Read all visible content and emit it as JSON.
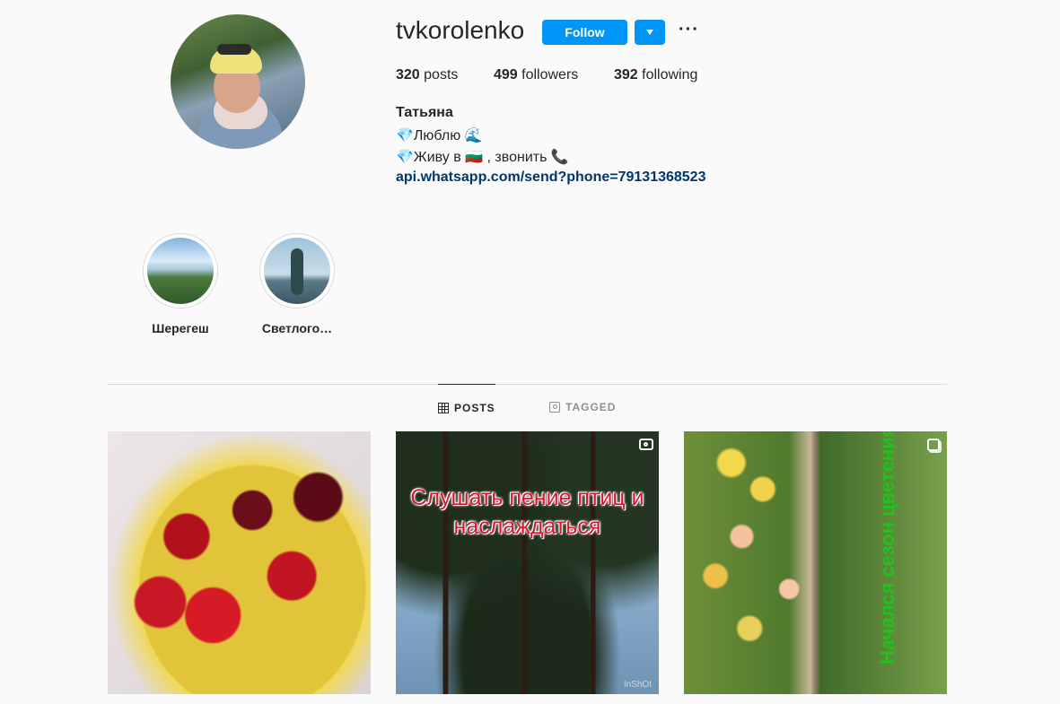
{
  "profile": {
    "username": "tvkorolenko",
    "follow_label": "Follow",
    "more_label": "···",
    "stats": {
      "posts_count": "320",
      "posts_label": " posts",
      "followers_count": "499",
      "followers_label": " followers",
      "following_count": "392",
      "following_label": " following"
    },
    "full_name": "Татьяна",
    "bio_line1": "💎Люблю 🌊",
    "bio_line2": "💎Живу в 🇧🇬 , звонить 📞",
    "link": "api.whatsapp.com/send?phone=79131368523"
  },
  "highlights": [
    {
      "label": "Шерегеш"
    },
    {
      "label": "Светлого…"
    }
  ],
  "tabs": [
    {
      "label": "POSTS",
      "icon": "grid-icon",
      "active": true
    },
    {
      "label": "TAGGED",
      "icon": "tag-icon",
      "active": false
    }
  ],
  "posts": [
    {
      "type": "image"
    },
    {
      "type": "video",
      "caption": "Слушать пение птиц и наслаждаться",
      "watermark": "InShOt"
    },
    {
      "type": "carousel",
      "caption": "Начался сезон цветения роз"
    }
  ],
  "colors": {
    "accent": "#0095f6",
    "link": "#00376b",
    "background": "#fafafa",
    "text": "#262626",
    "muted": "#8e8e8e"
  }
}
